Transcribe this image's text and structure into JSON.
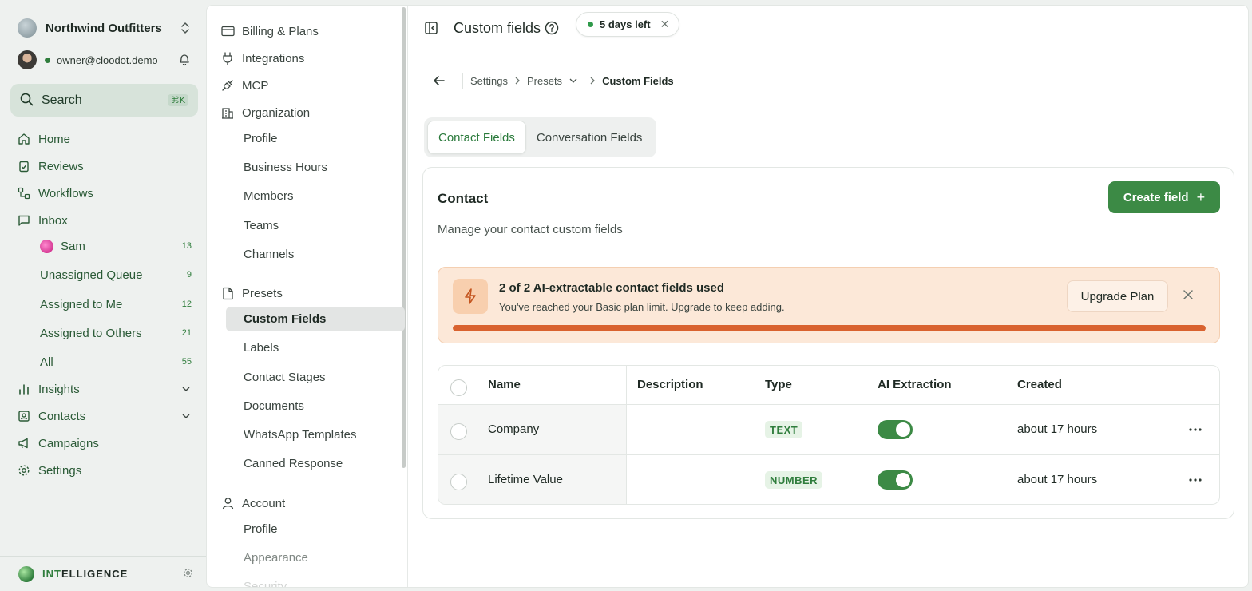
{
  "workspace": {
    "name": "Northwind Outfitters"
  },
  "user": {
    "email": "owner@cloodot.demo"
  },
  "search": {
    "label": "Search",
    "shortcut": "⌘K"
  },
  "nav": {
    "home": "Home",
    "reviews": "Reviews",
    "workflows": "Workflows",
    "inbox": "Inbox",
    "inbox_items": [
      {
        "label": "Sam",
        "count": "13"
      },
      {
        "label": "Unassigned Queue",
        "count": "9"
      },
      {
        "label": "Assigned to Me",
        "count": "12"
      },
      {
        "label": "Assigned to Others",
        "count": "21"
      },
      {
        "label": "All",
        "count": "55"
      }
    ],
    "insights": "Insights",
    "contacts": "Contacts",
    "campaigns": "Campaigns",
    "settings": "Settings"
  },
  "intelligence": {
    "prefix": "INT",
    "suffix": "ELLIGENCE"
  },
  "settings_nav": {
    "billing": "Billing & Plans",
    "integrations": "Integrations",
    "mcp": "MCP",
    "organization": "Organization",
    "org_items": [
      "Profile",
      "Business Hours",
      "Members",
      "Teams",
      "Channels"
    ],
    "presets": "Presets",
    "preset_items": [
      "Custom Fields",
      "Labels",
      "Contact Stages",
      "Documents",
      "WhatsApp Templates",
      "Canned Response"
    ],
    "account": "Account",
    "account_items": [
      "Profile",
      "Appearance",
      "Security"
    ]
  },
  "header": {
    "title": "Custom fields",
    "trial": "5 days left"
  },
  "breadcrumb": {
    "settings": "Settings",
    "presets": "Presets",
    "current": "Custom Fields"
  },
  "tabs": [
    "Contact Fields",
    "Conversation Fields"
  ],
  "card": {
    "title": "Contact",
    "description": "Manage your contact custom fields",
    "create_button": "Create field"
  },
  "banner": {
    "title": "2 of 2 AI-extractable contact fields used",
    "subtitle": "You've reached your Basic plan limit. Upgrade to keep adding.",
    "upgrade_button": "Upgrade Plan",
    "usage_fraction": 1.0
  },
  "table": {
    "columns": [
      "Name",
      "Description",
      "Type",
      "AI Extraction",
      "Created"
    ],
    "rows": [
      {
        "name": "Company",
        "description": "",
        "type": "TEXT",
        "ai_extraction": true,
        "created": "about 17 hours"
      },
      {
        "name": "Lifetime Value",
        "description": "",
        "type": "NUMBER",
        "ai_extraction": true,
        "created": "about 17 hours"
      }
    ]
  },
  "colors": {
    "accent": "#3c8a45",
    "warning_bg": "#fce8d8",
    "progress": "#d9622f"
  }
}
